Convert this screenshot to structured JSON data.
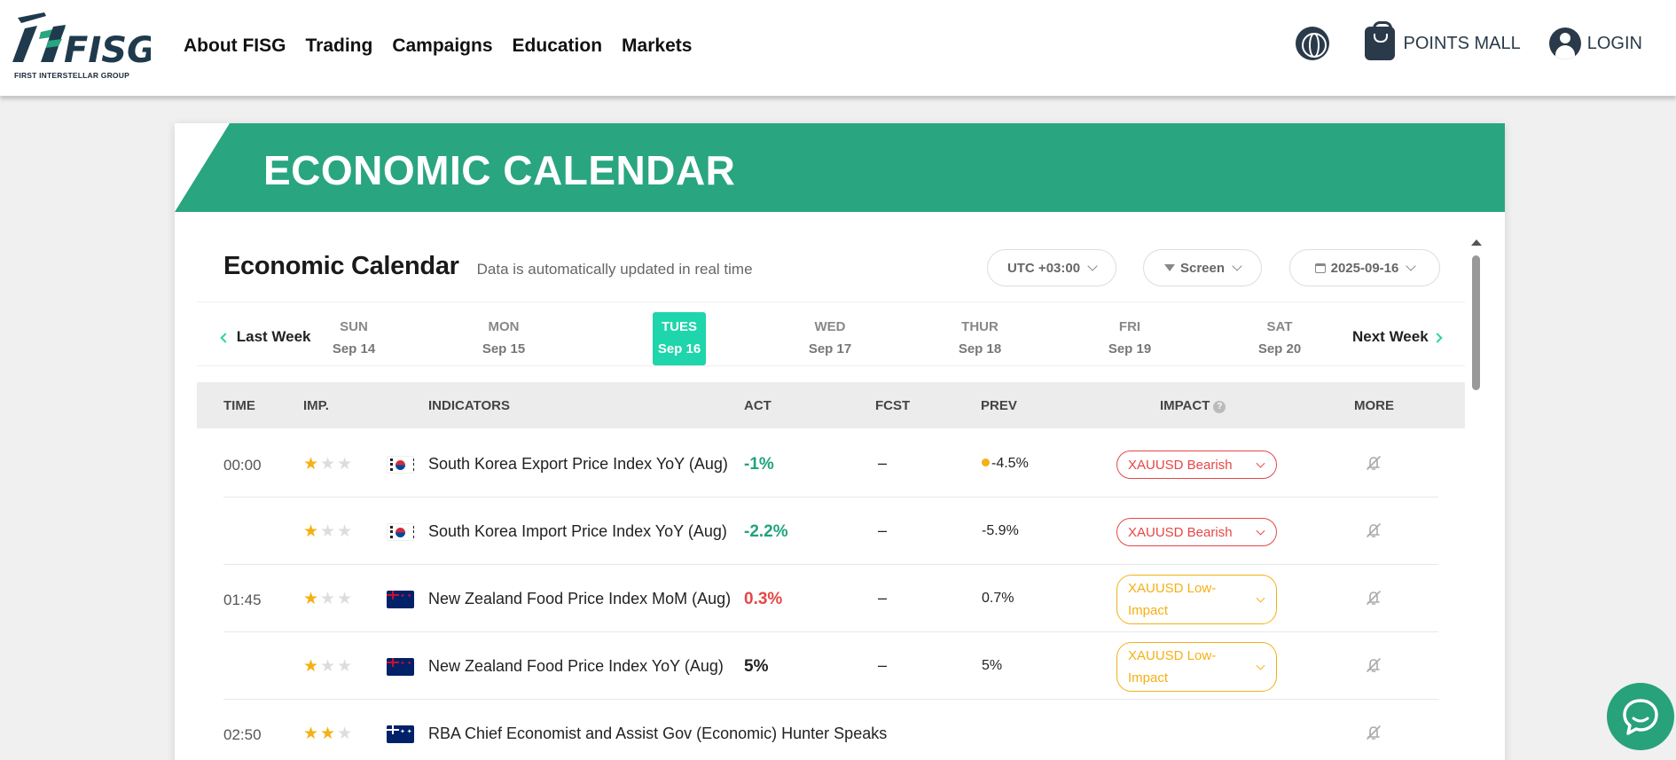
{
  "nav": {
    "logo_text": "FISG",
    "logo_sub": "FIRST INTERSTELLAR GROUP",
    "links": [
      "About FISG",
      "Trading",
      "Campaigns",
      "Education",
      "Markets"
    ],
    "points_mall": "POINTS MALL",
    "login": "LOGIN"
  },
  "banner": {
    "title": "ECONOMIC CALENDAR"
  },
  "calendar": {
    "title": "Economic Calendar",
    "subtitle": "Data is automatically updated in real time",
    "timezone": "UTC +03:00",
    "screen": "Screen",
    "date": "2025-09-16"
  },
  "week": {
    "prev": "Last Week",
    "next": "Next Week",
    "days": [
      {
        "name": "SUN",
        "date": "Sep 14"
      },
      {
        "name": "MON",
        "date": "Sep 15"
      },
      {
        "name": "TUES",
        "date": "Sep 16"
      },
      {
        "name": "WED",
        "date": "Sep 17"
      },
      {
        "name": "THUR",
        "date": "Sep 18"
      },
      {
        "name": "FRI",
        "date": "Sep 19"
      },
      {
        "name": "SAT",
        "date": "Sep 20"
      }
    ],
    "selected_index": 2
  },
  "table": {
    "headers": {
      "time": "TIME",
      "imp": "IMP.",
      "indicators": "INDICATORS",
      "act": "ACT",
      "fcst": "FCST",
      "prev": "PREV",
      "impact": "IMPACT",
      "more": "MORE"
    },
    "rows": [
      {
        "time": "00:00",
        "stars": 1,
        "flag": "south-korea-flag",
        "indicator": "South Korea Export Price Index YoY (Aug)",
        "act": "-1%",
        "act_color": "green",
        "fcst": "–",
        "prev": "-4.5%",
        "prev_dot": true,
        "impact": "XAUUSD Bearish",
        "impact_type": "bearish"
      },
      {
        "time": "",
        "stars": 1,
        "flag": "south-korea-flag",
        "indicator": "South Korea Import Price Index YoY (Aug)",
        "act": "-2.2%",
        "act_color": "green",
        "fcst": "–",
        "prev": "-5.9%",
        "prev_dot": false,
        "impact": "XAUUSD Bearish",
        "impact_type": "bearish"
      },
      {
        "time": "01:45",
        "stars": 1,
        "flag": "new-zealand-flag",
        "indicator": "New Zealand Food Price Index MoM (Aug)",
        "act": "0.3%",
        "act_color": "red",
        "fcst": "–",
        "prev": "0.7%",
        "prev_dot": false,
        "impact": "XAUUSD Low-Impact",
        "impact_type": "low"
      },
      {
        "time": "",
        "stars": 1,
        "flag": "new-zealand-flag",
        "indicator": "New Zealand Food Price Index YoY (Aug)",
        "act": "5%",
        "act_color": "dark",
        "fcst": "–",
        "prev": "5%",
        "prev_dot": false,
        "impact": "XAUUSD Low-Impact",
        "impact_type": "low"
      },
      {
        "time": "02:50",
        "stars": 2,
        "flag": "australia-flag",
        "indicator": "RBA Chief Economist and Assist Gov (Economic) Hunter Speaks",
        "act": "",
        "act_color": "dark",
        "fcst": "",
        "prev": "",
        "prev_dot": false,
        "impact": "",
        "impact_type": "none"
      }
    ]
  },
  "colors": {
    "brand_green": "#29a57f",
    "selected_day": "#1fd5ab",
    "bearish": "#e64646",
    "low_impact": "#f5b014",
    "act_positive": "#21a37e"
  },
  "icons": {
    "language": "globe-icon",
    "points_mall": "shopping-bag-icon",
    "login": "user-icon",
    "more": "bell-off-icon",
    "chat": "chat-icon"
  }
}
